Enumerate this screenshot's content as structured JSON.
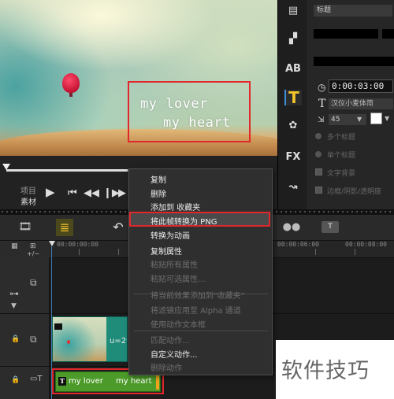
{
  "preview": {
    "title_line_1": "my lover",
    "title_line_2": "my heart"
  },
  "player": {
    "project_label": "项目",
    "material_label": "素材",
    "scrub_progress": 0.46
  },
  "options": {
    "title_field": "标题",
    "timecode": "0:00:03:00",
    "font_field": "汉仪小麦体简",
    "font_size": "45",
    "text_color": "#ffffff",
    "faded_option_1": "多个标题",
    "faded_option_2": "单个标题",
    "faded_option_3": "文字背景",
    "faded_option_4": "边框/阴影/透明度"
  },
  "timeline": {
    "ruler_times": [
      "00:00:00:00",
      "00:00:06:00",
      "00:00:08:00"
    ],
    "video_clip_label": "u=29",
    "title_clip_label_1": "my lover",
    "title_clip_label_2": "my heart"
  },
  "context_menu": {
    "items": [
      {
        "label": "复制",
        "enabled": true
      },
      {
        "label": "删除",
        "enabled": true
      },
      {
        "label": "添加到 收藏夹",
        "enabled": true
      },
      {
        "label": "将此帧转换为 PNG",
        "enabled": true,
        "highlighted": true
      },
      {
        "label": "转换为动画",
        "enabled": true
      },
      {
        "label": "复制属性",
        "enabled": true
      },
      {
        "label": "粘贴所有属性",
        "enabled": false
      },
      {
        "label": "粘贴可选属性...",
        "enabled": false
      },
      {
        "label": "将当前效果添加到\"收藏夹\"",
        "enabled": false
      },
      {
        "label": "将滤镜应用至 Alpha 通道",
        "enabled": false
      },
      {
        "label": "使用动作文本框",
        "enabled": false
      },
      {
        "label": "匹配动作...",
        "enabled": false
      },
      {
        "label": "自定义动作...",
        "enabled": true
      },
      {
        "label": "删除动作",
        "enabled": false
      }
    ]
  },
  "watermark": {
    "text": "软件技巧"
  },
  "colors": {
    "highlight_border": "#e0282c",
    "active_icon": "#f1c22a",
    "title_clip": "#4c9b2a",
    "video_clip": "#1f8c7a"
  }
}
